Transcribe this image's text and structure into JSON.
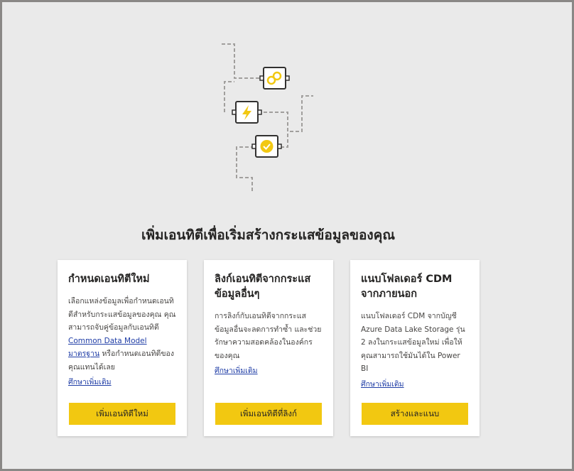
{
  "headline": "เพิ่มเอนทิตีเพื่อเริ่มสร้างกระแสข้อมูลของคุณ",
  "cards": [
    {
      "title": "กำหนดเอนทิตีใหม่",
      "desc_before": "เลือกแหล่งข้อมูลเพื่อกำหนดเอนทิตีสำหรับกระแสข้อมูลของคุณ คุณสามารถจับคู่ข้อมูลกับเอนทิตี ",
      "desc_link": "Common Data Model มาตรฐาน",
      "desc_after": " หรือกำหนดเอนทิตีของคุณแทนได้เลย",
      "learn_more": "ศึกษาเพิ่มเติม",
      "button": "เพิ่มเอนทิตีใหม่"
    },
    {
      "title": "ลิงก์เอนทิตีจากกระแสข้อมูลอื่นๆ",
      "desc": "การลิงก์กับเอนทิตีจากกระแสข้อมูลอื่นจะลดการทำซ้ำ และช่วยรักษาความสอดคล้องในองค์กรของคุณ",
      "learn_more": "ศึกษาเพิ่มเติม",
      "button": "เพิ่มเอนทิตีที่ลิงก์"
    },
    {
      "title": "แนบโฟลเดอร์ CDM จากภายนอก",
      "desc": "แนบโฟลเดอร์ CDM จากบัญชี Azure Data Lake Storage รุ่น 2 ลงในกระแสข้อมูลใหม่ เพื่อให้คุณสามารถใช้มันได้ใน Power BI",
      "learn_more": "ศึกษาเพิ่มเติม",
      "button": "สร้างและแนบ"
    }
  ],
  "icons": [
    "link-icon",
    "lightning-icon",
    "verified-badge-icon"
  ],
  "colors": {
    "accent": "#f2c811",
    "link": "#1f3da6",
    "background": "#eaeaea"
  }
}
